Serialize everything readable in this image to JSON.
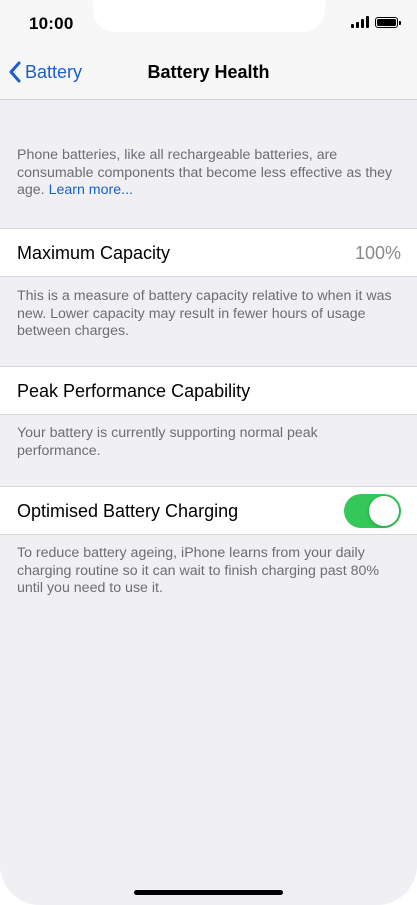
{
  "status_bar": {
    "time": "10:00",
    "icons": [
      "cellular-signal-icon",
      "battery-icon"
    ]
  },
  "nav": {
    "back_label": "Battery",
    "back_icon": "chevron-left-icon",
    "title": "Battery Health"
  },
  "intro": {
    "text": "Phone batteries, like all rechargeable batteries, are consumable components that become less effective as they age.",
    "link": "Learn more..."
  },
  "maximum_capacity": {
    "label": "Maximum Capacity",
    "value": "100%",
    "footnote": "This is a measure of battery capacity relative to when it was new. Lower capacity may result in fewer hours of usage between charges."
  },
  "peak_performance": {
    "label": "Peak Performance Capability",
    "footnote": "Your battery is currently supporting normal peak performance."
  },
  "optimised_charging": {
    "label": "Optimised Battery Charging",
    "enabled": true,
    "footnote": "To reduce battery ageing, iPhone learns from your daily charging routine so it can wait to finish charging past 80% until you need to use it."
  },
  "colors": {
    "accent": "#1a5fc8",
    "toggle_on": "#34c759",
    "background": "#efeff4"
  }
}
